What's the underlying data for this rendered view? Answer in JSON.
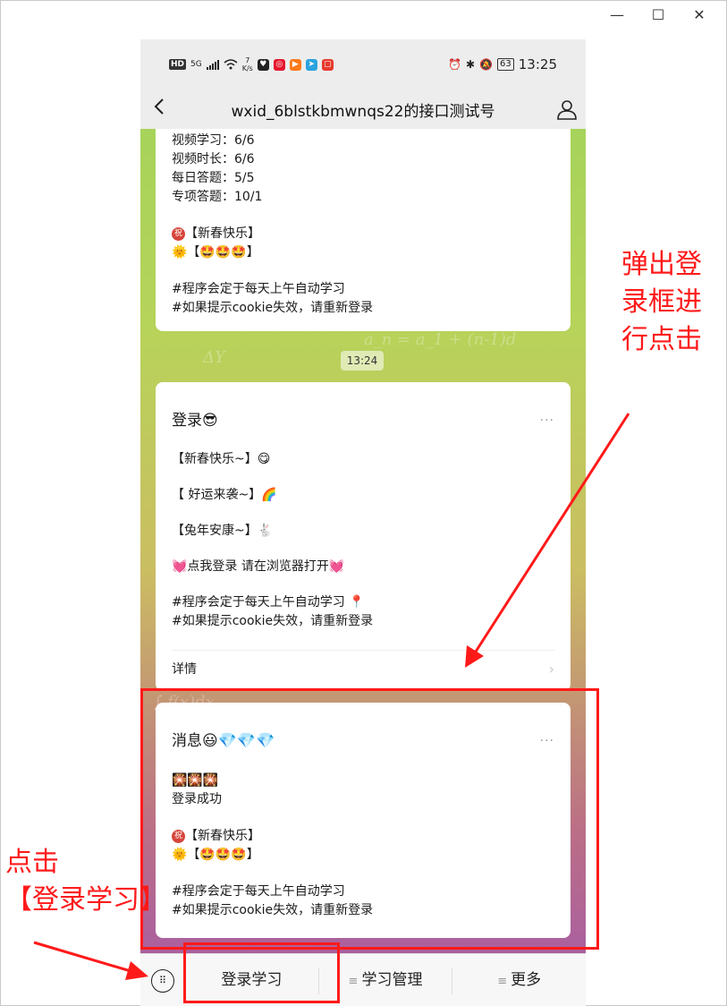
{
  "window": {
    "controls": [
      "—",
      "☐",
      "✕"
    ]
  },
  "status_bar": {
    "left": {
      "hd": "HD",
      "network": "5G",
      "speed_value": "7",
      "speed_unit": "K/s"
    },
    "right": {
      "battery": "63",
      "time": "13:25"
    }
  },
  "nav": {
    "title": "wxid_6blstkbmwnqs22的接口测试号"
  },
  "card1": {
    "lines": [
      "视频学习：6/6",
      "视频时长：6/6",
      "每日答题：5/5",
      "专项答题：10/1"
    ],
    "zhu_badge": "祝",
    "greeting": "【新春快乐】",
    "emoji_line": "🌞【🤩🤩🤩】",
    "note1": "#程序会定于每天上午自动学习",
    "note2": " #如果提示cookie失效，请重新登录"
  },
  "timestamp": "13:24",
  "card2": {
    "title": "登录😎",
    "more": "···",
    "items": [
      "【新春快乐~】😋",
      "【 好运来袭~】🌈",
      "【兔年安康~】🐇"
    ],
    "login_link": "💓点我登录 请在浏览器打开💓",
    "note1": "#程序会定于每天上午自动学习 📍",
    "note2": "#如果提示cookie失效，请重新登录",
    "details": "详情",
    "chevron": "›"
  },
  "card3": {
    "title": "消息😃💎💎💎",
    "more": "···",
    "fireworks": "🎇🎇🎇",
    "status": "登录成功",
    "zhu_badge": "祝",
    "greeting": "【新春快乐】",
    "emoji_line": "🌞【🤩🤩🤩】",
    "note1": "#程序会定于每天上午自动学习",
    "note2": " #如果提示cookie失效，请重新登录"
  },
  "bottom_menu": {
    "items": [
      {
        "label": "登录学习"
      },
      {
        "label": "学习管理"
      },
      {
        "label": "更多"
      }
    ],
    "menu_glyph": "≡"
  },
  "annotations": {
    "right_lines": [
      "弹出登",
      "录框进",
      "行点击"
    ],
    "left_lines": [
      "点击",
      "【登录学习】"
    ]
  },
  "colors": {
    "annotation": "#ff1a1a",
    "chat_top": "#9fd35a",
    "chat_bottom": "#a35aa9",
    "bar_bg": "#ededed"
  },
  "icons": [
    "back-arrow-icon",
    "user-icon",
    "keyboard-icon",
    "more-dots-icon",
    "chevron-right-icon",
    "battery-icon",
    "wifi-icon",
    "bluetooth-icon",
    "alarm-icon",
    "mute-icon"
  ]
}
